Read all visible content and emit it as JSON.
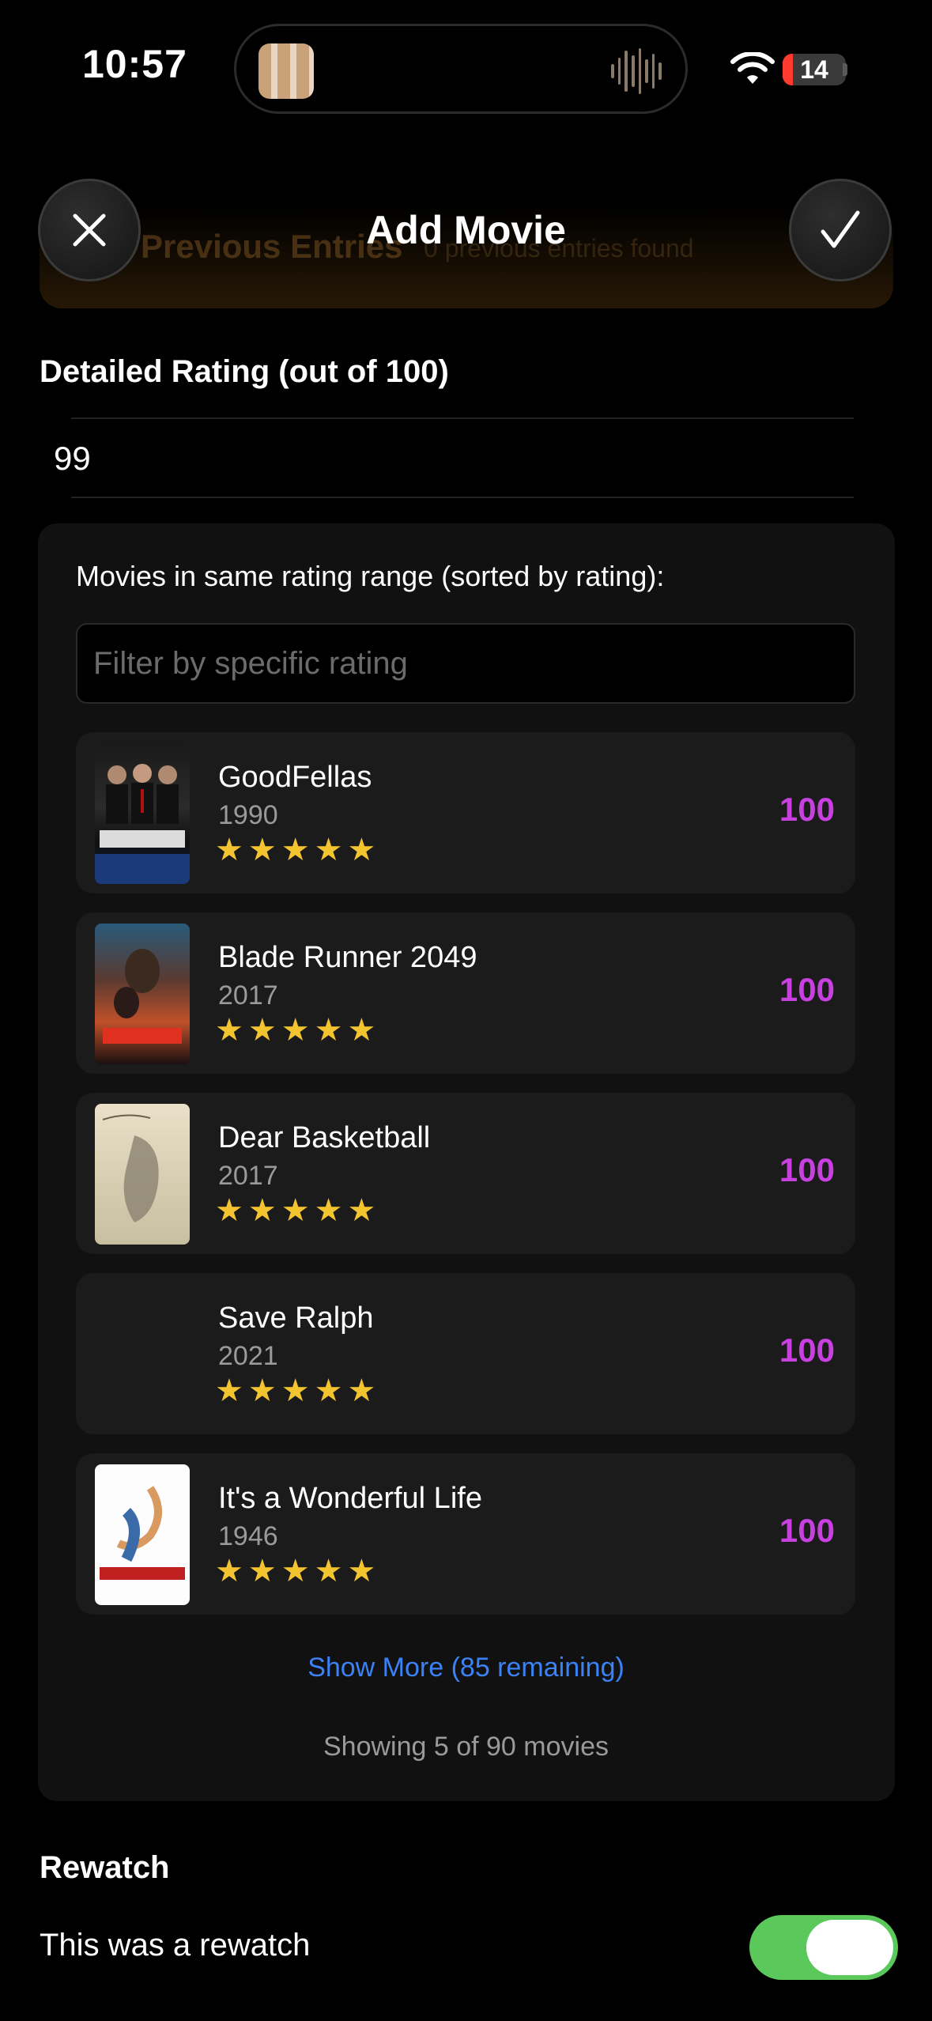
{
  "status_bar": {
    "time": "10:57",
    "battery": "14"
  },
  "header": {
    "title": "Add Movie",
    "behind_title": "Previous Entries",
    "behind_subtitle": "0 previous entries found"
  },
  "rating": {
    "label": "Detailed Rating (out of 100)",
    "value": "99"
  },
  "similar": {
    "heading": "Movies in same rating range (sorted by rating):",
    "filter_placeholder": "Filter by specific rating",
    "movies": [
      {
        "title": "GoodFellas",
        "year": "1990",
        "stars": "★★★★★",
        "score": "100"
      },
      {
        "title": "Blade Runner 2049",
        "year": "2017",
        "stars": "★★★★★",
        "score": "100"
      },
      {
        "title": "Dear Basketball",
        "year": "2017",
        "stars": "★★★★★",
        "score": "100"
      },
      {
        "title": "Save Ralph",
        "year": "2021",
        "stars": "★★★★★",
        "score": "100"
      },
      {
        "title": "It's a Wonderful Life",
        "year": "1946",
        "stars": "★★★★★",
        "score": "100"
      }
    ],
    "show_more": "Show More (85 remaining)",
    "showing": "Showing 5 of 90 movies"
  },
  "rewatch": {
    "heading": "Rewatch",
    "label": "This was a rewatch",
    "enabled": true
  },
  "colors": {
    "accent_score": "#c840e0",
    "star": "#f4c430",
    "link": "#3b82f6",
    "toggle_on": "#5ac85a"
  }
}
